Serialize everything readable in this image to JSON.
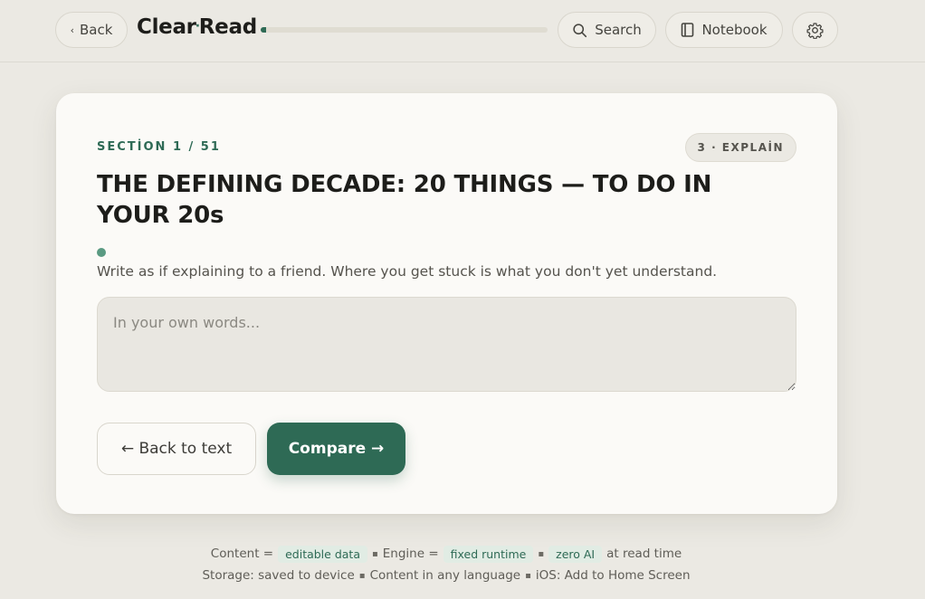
{
  "header": {
    "back_label": "Back",
    "brand_left": "Clear",
    "brand_dot": "·",
    "brand_right": "Read",
    "progress_fraction": 0.0196,
    "search_label": "Search",
    "notebook_label": "Notebook"
  },
  "icons": {
    "back": "chevron-left-icon",
    "search": "search-icon",
    "notebook": "notebook-icon",
    "settings": "gear-icon"
  },
  "card": {
    "section_label": "SECTİON 1 / 51",
    "step_badge": "3 · EXPLAİN",
    "title": "THE DEFINING DECADE: 20 THINGS — TO DO IN YOUR 20s",
    "instruction": "Write as if explaining to a friend. Where you get stuck is what you don't yet understand.",
    "answer_placeholder": "In your own words...",
    "answer_value": "",
    "back_to_text_label": "← Back to text",
    "compare_label": "Compare →"
  },
  "footer": {
    "content_prefix": "Content =",
    "content_chip": "editable data",
    "engine_prefix": "Engine =",
    "engine_chip": "fixed runtime",
    "ai_chip": "zero AI",
    "ai_suffix": "at read time",
    "storage": "Storage: saved to device",
    "language": "Content in any language",
    "ios": "iOS: Add to Home Screen"
  },
  "colors": {
    "accent": "#2e6a55",
    "background": "#ebe9e3",
    "card": "#fbfaf7",
    "chip_bg": "#e1ece4"
  }
}
